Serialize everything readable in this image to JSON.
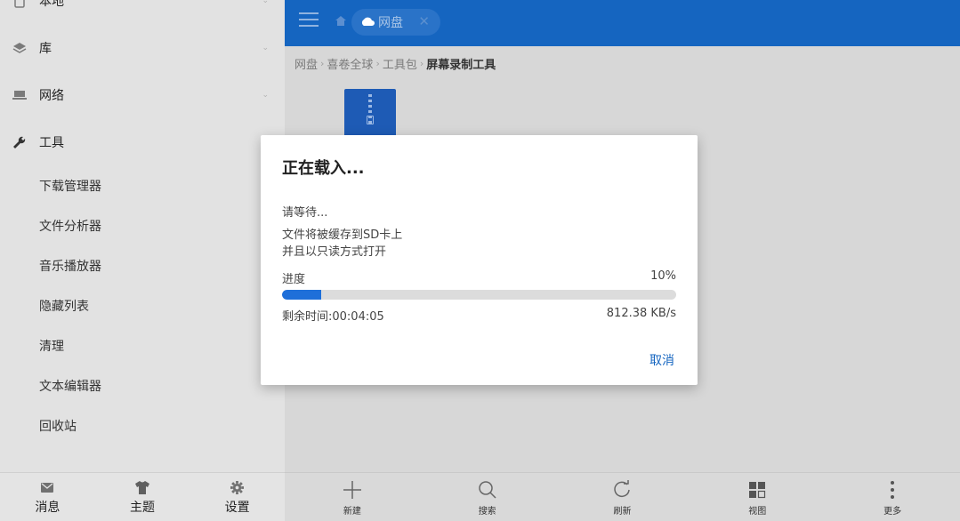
{
  "sidebar": {
    "nav": [
      {
        "label": "本地",
        "icon": "phone-icon"
      },
      {
        "label": "库",
        "icon": "layers-icon"
      },
      {
        "label": "网络",
        "icon": "network-icon"
      },
      {
        "label": "工具",
        "icon": "wrench-icon"
      }
    ],
    "tools": [
      "下载管理器",
      "文件分析器",
      "音乐播放器",
      "隐藏列表",
      "清理",
      "文本编辑器",
      "回收站"
    ],
    "bottom": [
      {
        "label": "消息",
        "icon": "mail-icon"
      },
      {
        "label": "主题",
        "icon": "shirt-icon"
      },
      {
        "label": "设置",
        "icon": "gear-icon"
      }
    ]
  },
  "topbar": {
    "tab_label": "网盘",
    "tab_close": "✕",
    "accent_color": "#1565c0"
  },
  "breadcrumb": {
    "items": [
      "网盘",
      "喜卷全球",
      "工具包"
    ],
    "current": "屏幕录制工具",
    "separator": "›"
  },
  "dialog": {
    "title": "正在载入...",
    "message": [
      "请等待...",
      "文件将被缓存到SD卡上",
      "并且以只读方式打开"
    ],
    "progress_label": "进度",
    "progress_percent_text": "10%",
    "progress_value": 0.1,
    "time_left": "剩余时间:00:04:05",
    "speed": "812.38 KB/s",
    "cancel_label": "取消"
  },
  "toolbar": {
    "items": [
      {
        "label": "新建",
        "icon": "plus-icon"
      },
      {
        "label": "搜索",
        "icon": "search-icon"
      },
      {
        "label": "刷新",
        "icon": "refresh-icon"
      },
      {
        "label": "视图",
        "icon": "grid-view-icon"
      },
      {
        "label": "更多",
        "icon": "more-vertical-icon"
      }
    ]
  }
}
